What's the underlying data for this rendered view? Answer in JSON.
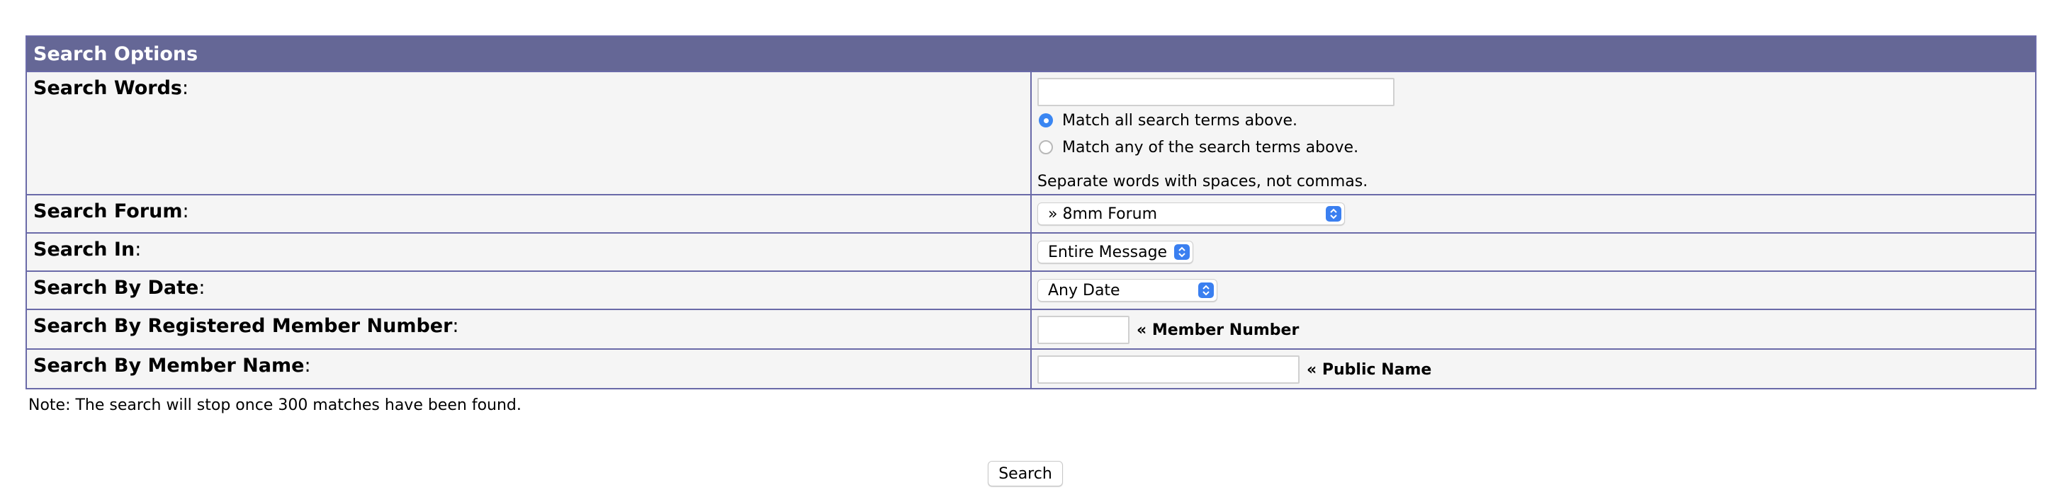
{
  "header": {
    "title": "Search Options"
  },
  "rows": {
    "words": {
      "label": "Search Words",
      "colon": ":",
      "value": "",
      "radio_all": "Match all search terms above.",
      "radio_any": "Match any of the search terms above.",
      "hint": "Separate words with spaces, not commas."
    },
    "forum": {
      "label": "Search Forum",
      "colon": ":",
      "selected": "» 8mm Forum"
    },
    "in": {
      "label": "Search In",
      "colon": ":",
      "selected": "Entire Message"
    },
    "date": {
      "label": "Search By Date",
      "colon": ":",
      "selected": "Any Date"
    },
    "member": {
      "label": "Search By Registered Member Number",
      "colon": ":",
      "value": "",
      "suffix": "« Member Number"
    },
    "name": {
      "label": "Search By Member Name",
      "colon": ":",
      "value": "",
      "suffix": "« Public Name"
    }
  },
  "note": "Note: The search will stop once 300 matches have been found.",
  "button": {
    "search_label": "Search"
  },
  "colors": {
    "header_bg": "#656796",
    "border": "#6a6aa8",
    "cell_bg": "#f5f5f5",
    "accent": "#3a86f2"
  },
  "icons": {
    "select_arrow": "up-down-chevron-icon"
  }
}
